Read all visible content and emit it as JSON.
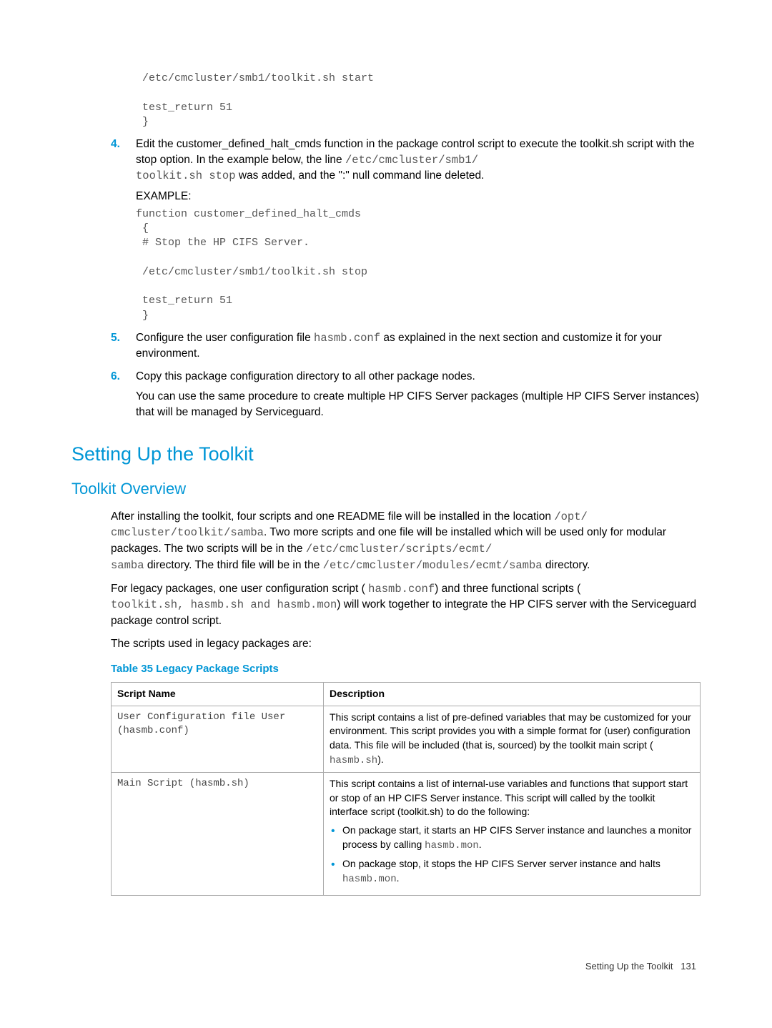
{
  "codeBlock1": " /etc/cmcluster/smb1/toolkit.sh start\n\n test_return 51\n }",
  "step4": {
    "num": "4.",
    "body_pre": "Edit the customer_defined_halt_cmds function in the package control script to execute the toolkit.sh script with the stop option. In the example below, the line ",
    "code1": "/etc/cmcluster/smb1/",
    "code2": "toolkit.sh stop",
    "body_mid": " was added, and the \":\" null command line deleted.",
    "example": "EXAMPLE:"
  },
  "codeBlock2": "function customer_defined_halt_cmds\n {\n # Stop the HP CIFS Server.\n\n /etc/cmcluster/smb1/toolkit.sh stop\n\n test_return 51\n }",
  "step5": {
    "num": "5.",
    "body_pre": "Configure the user configuration file ",
    "code": "hasmb.conf",
    "body_post": " as explained in the next section and customize it for your environment."
  },
  "step6": {
    "num": "6.",
    "body": "Copy this package configuration directory to all other package nodes.",
    "extra": "You can use the same procedure to create multiple HP CIFS Server packages (multiple HP CIFS Server instances) that will be managed by Serviceguard."
  },
  "sectionTitle": "Setting Up the Toolkit",
  "subsectionTitle": "Toolkit Overview",
  "overview": {
    "p1_a": "After installing the toolkit, four scripts and one README file will be installed in the location ",
    "p1_c1": "/opt/",
    "p1_c2": "cmcluster/toolkit/samba",
    "p1_b": ". Two more scripts and one file will be installed which will be used only for modular packages. The two scripts will be in the ",
    "p1_c3": "/etc/cmcluster/scripts/ecmt/",
    "p1_c4": "samba",
    "p1_c": " directory. The third file will be in the ",
    "p1_c5": "/etc/cmcluster/modules/ecmt/samba",
    "p1_d": " directory.",
    "p2_a": "For legacy packages, one user configuration script ( ",
    "p2_c1": "hasmb.conf",
    "p2_b": ") and three functional scripts ( ",
    "p2_c2": "toolkit.sh, hasmb.sh and hasmb.mon",
    "p2_c": ") will work together to integrate the HP CIFS server with the Serviceguard package control script.",
    "p3": "The scripts used in legacy packages are:"
  },
  "tableTitle": "Table 35 Legacy Package Scripts",
  "table": {
    "h1": "Script Name",
    "h2": "Description",
    "r1_c1": "User Configuration file User (hasmb.conf)",
    "r1_c2_a": "This script contains a list of pre-defined variables that may be customized for your environment. This script provides you with a simple format for (user) configuration data. This file will be included (that is, sourced) by the toolkit main script ( ",
    "r1_c2_code": "hasmb.sh",
    "r1_c2_b": ").",
    "r2_c1": "Main Script (hasmb.sh)",
    "r2_c2_para": "This script contains a list of internal-use variables and functions that support start or stop of an HP CIFS Server instance. This script will called by the toolkit interface script (toolkit.sh) to do the following:",
    "r2_b1_a": "On package start, it starts an HP CIFS Server instance and launches a monitor process by calling ",
    "r2_b1_code": "hasmb.mon",
    "r2_b1_b": ".",
    "r2_b2_a": "On package stop, it stops the HP CIFS Server server instance and halts ",
    "r2_b2_code": "hasmb.mon",
    "r2_b2_b": "."
  },
  "footer": {
    "title": "Setting Up the Toolkit",
    "page": "131"
  }
}
